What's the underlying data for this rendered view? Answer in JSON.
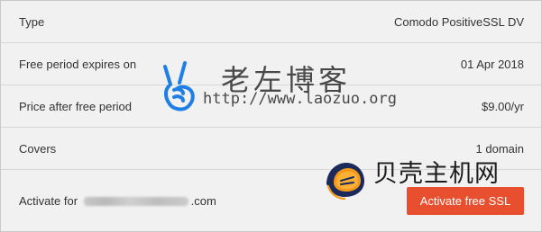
{
  "rows": [
    {
      "label": "Type",
      "value": "Comodo PositiveSSL DV"
    },
    {
      "label": "Free period expires on",
      "value": "01 Apr 2018"
    },
    {
      "label": "Price after free period",
      "value": "$9.00/yr"
    },
    {
      "label": "Covers",
      "value": "1 domain"
    }
  ],
  "activate": {
    "label_prefix": "Activate for",
    "domain_suffix": ".com",
    "button_label": "Activate free SSL"
  },
  "watermarks": {
    "laozuo": {
      "icon": "victory-hand-icon",
      "title": "老左博客",
      "url": "http://www.laozuo.org"
    },
    "beikezhuji": {
      "icon": "shell-logo-icon",
      "text": "贝壳主机网"
    }
  },
  "colors": {
    "background": "#f1f1f1",
    "divider": "#d7d7d7",
    "text": "#333333",
    "button_bg": "#e84f2e",
    "button_text": "#ffffff",
    "watermark_blue": "#1f7fe6",
    "logo_orange": "#f39a1b",
    "logo_dark": "#1b2a5a"
  }
}
